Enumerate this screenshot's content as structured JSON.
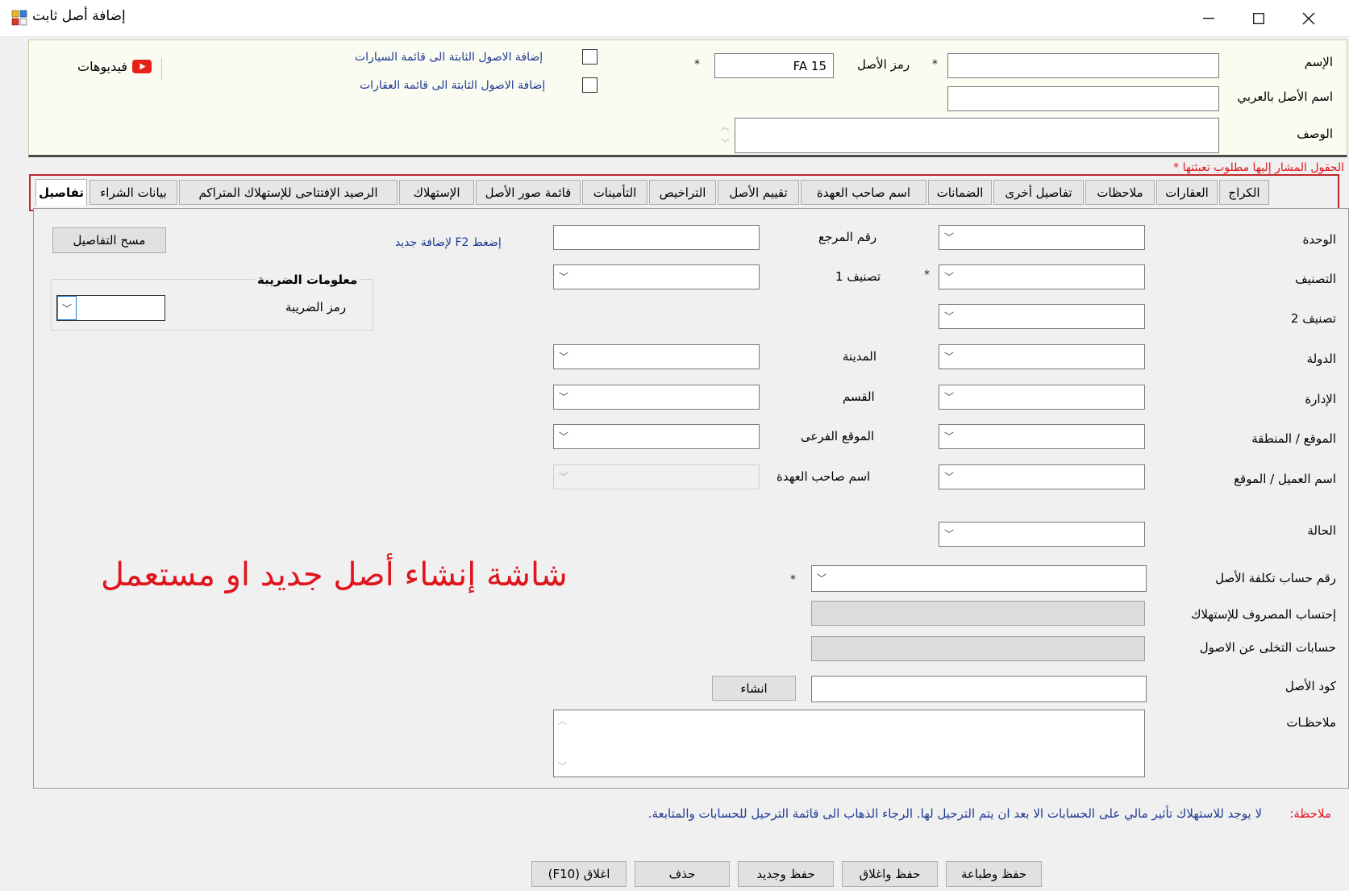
{
  "window": {
    "title": "إضافة أصل ثابت",
    "minimize": "—",
    "maximize": "☐",
    "close": "✕"
  },
  "header": {
    "name_label": "الإسم",
    "name_value": "",
    "asset_code_label": "رمز الأصل",
    "asset_code_value": "FA 15",
    "arabic_name_label": "اسم الأصل بالعربي",
    "arabic_name_value": "",
    "description_label": "الوصف",
    "description_value": "",
    "required_mark": "*",
    "add_to_vehicles": "إضافة الاصول الثابتة الى قائمة السيارات",
    "add_to_real_estate": "إضافة الاصول الثابتة الى قائمة العقارات",
    "videos_label": "فيديوهات",
    "required_note": "الحقول المشار إليها مطلوب تعبئتها *"
  },
  "tabs": [
    {
      "label": "الكراج"
    },
    {
      "label": "العقارات"
    },
    {
      "label": "ملاحظات"
    },
    {
      "label": "تفاصيل أخرى"
    },
    {
      "label": "الضمانات"
    },
    {
      "label": "اسم صاحب العهدة"
    },
    {
      "label": "تقييم الأصل"
    },
    {
      "label": "التراخيص"
    },
    {
      "label": "التأمينات"
    },
    {
      "label": "قائمة صور الأصل"
    },
    {
      "label": "الإستهلاك"
    },
    {
      "label": "الرصيد الإفتتاحى للإستهلاك المتراكم"
    },
    {
      "label": "بيانات الشراء"
    },
    {
      "label": "تفاصيل"
    }
  ],
  "details": {
    "unit_label": "الوحدة",
    "category_label": "التصنيف",
    "category2_label": "تصنيف 2",
    "country_label": "الدولة",
    "management_label": "الإدارة",
    "location_label": "الموقع / المنطقة",
    "customer_location_label": "اسم العميل / الموقع",
    "status_label": "الحالة",
    "reference_label": "رقم المرجع",
    "category1_label": "تصنيف 1",
    "city_label": "المدينة",
    "department_label": "القسم",
    "sublocation_label": "الموقع الفرعى",
    "custodian_label": "اسم صاحب العهدة",
    "cost_account_label": "رقم حساب تكلفة الأصل",
    "depreciation_expense_label": "إحتساب المصروف للإستهلاك",
    "disposal_accounts_label": "حسابات التخلى عن الاصول",
    "asset_code_label": "كود الأصل",
    "notes_label": "ملاحظـات",
    "create_button": "انشاء",
    "f2_hint": "إضغط F2 لإضافة جديد",
    "clear_button": "مسح التفاصيل",
    "tax_group_title": "معلومات الضريبة",
    "tax_code_label": "رمز الضريبة"
  },
  "watermark": "شاشة إنشاء أصل جديد او مستعمل",
  "footer": {
    "note_prefix": "ملاحظة:",
    "note_text": "لا يوجد للاستهلاك تأثير مالي على الحسابات الا بعد ان يتم الترحيل لها. الرجاء الذهاب الى قائمة الترحيل للحسابات والمتابعة.",
    "save_print": "حفظ وطباعة",
    "save_close": "حفظ واغلاق",
    "save_new": "حفظ وجديد",
    "delete": "حذف",
    "close": "اغلاق (F10)"
  },
  "colors": {
    "accent_red": "#e0141c",
    "link_blue": "#1f3a93",
    "youtube_red": "#e62117"
  }
}
